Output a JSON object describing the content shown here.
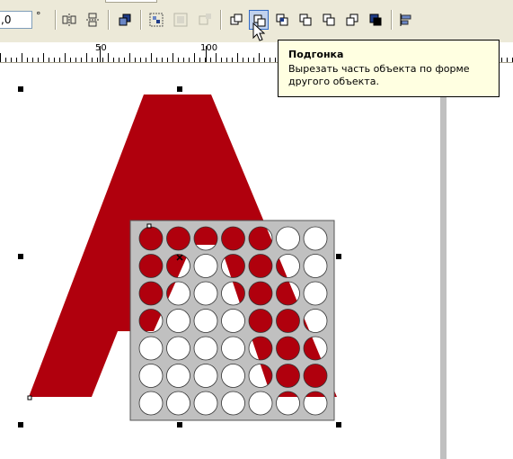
{
  "toolbar": {
    "angle_value": ",0",
    "angle_unit": "°",
    "buttons": [
      {
        "name": "mirror-horizontal-button"
      },
      {
        "name": "mirror-vertical-button"
      },
      {
        "name": "to-front-button"
      },
      {
        "name": "group-button"
      },
      {
        "name": "ungroup-button"
      },
      {
        "name": "ungroup-all-button"
      },
      {
        "name": "weld-button"
      },
      {
        "name": "trim-button"
      },
      {
        "name": "intersect-button"
      },
      {
        "name": "simplify-button"
      },
      {
        "name": "front-minus-back-button"
      },
      {
        "name": "back-minus-front-button"
      },
      {
        "name": "create-boundary-button"
      },
      {
        "name": "align-distribute-button"
      }
    ]
  },
  "ruler": {
    "labels": [
      "50",
      "100"
    ]
  },
  "tooltip": {
    "title": "Подгонка",
    "text": "Вырезать часть объекта по форме другого объекта."
  },
  "colors": {
    "letter": "#b0000d",
    "grid_background": "#c0c0c0",
    "tooltip_bg": "#ffffe1",
    "toolbar_bg": "#ece9d8",
    "selection_accent": "#316ac5"
  },
  "icons": [
    "cursor-arrow-icon",
    "close-x-icon"
  ]
}
